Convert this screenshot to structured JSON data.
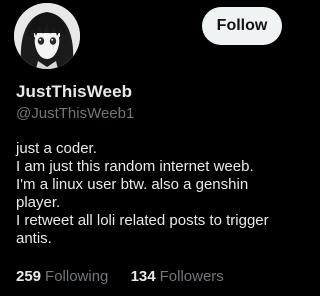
{
  "profile": {
    "display_name": "JustThisWeeb",
    "handle": "@JustThisWeeb1",
    "avatar_icon": "anime-girl-avatar",
    "follow_label": "Follow",
    "bio_lines": [
      "just a coder.",
      "I am just this random internet weeb.",
      "I'm a linux user btw. also a genshin",
      "player.",
      "I retweet all loli related posts to trigger",
      "antis."
    ],
    "following_count": "259",
    "following_label": "Following",
    "followers_count": "134",
    "followers_label": "Followers"
  },
  "colors": {
    "background": "#000000",
    "primary_text": "#e7e9ea",
    "secondary_text": "#71767b",
    "follow_button_bg": "#eff3f4",
    "follow_button_text": "#0f1419"
  }
}
